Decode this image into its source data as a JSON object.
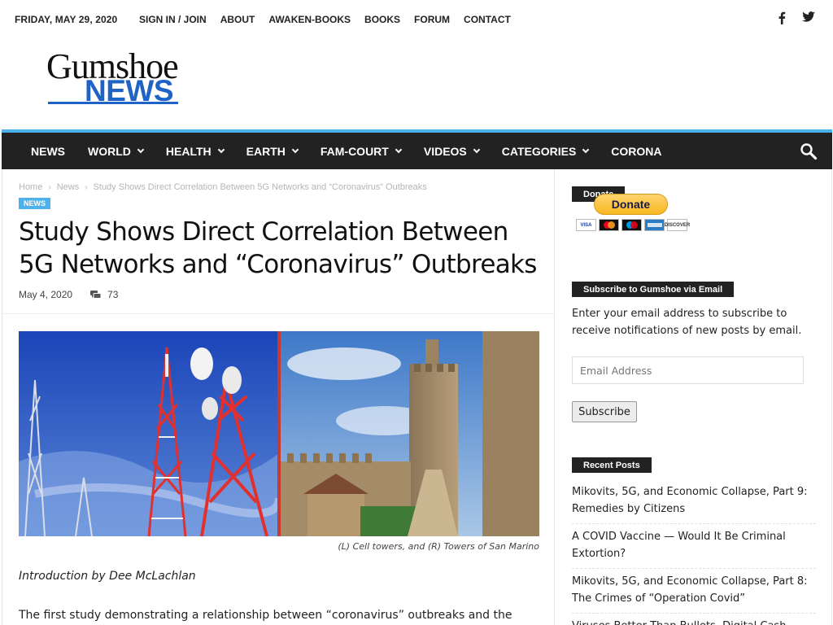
{
  "topbar": {
    "date": "FRIDAY, MAY 29, 2020",
    "menu": [
      "SIGN IN / JOIN",
      "ABOUT",
      "AWAKEN-BOOKS",
      "BOOKS",
      "FORUM",
      "CONTACT"
    ],
    "social": [
      "facebook-icon",
      "twitter-icon"
    ]
  },
  "logo": {
    "line1": "Gumshoe",
    "line2": "NEWS"
  },
  "nav": {
    "items": [
      {
        "label": "NEWS",
        "dropdown": false
      },
      {
        "label": "WORLD",
        "dropdown": true
      },
      {
        "label": "HEALTH",
        "dropdown": true
      },
      {
        "label": "EARTH",
        "dropdown": true
      },
      {
        "label": "FAM-COURT",
        "dropdown": true
      },
      {
        "label": "VIDEOS",
        "dropdown": true
      },
      {
        "label": "CATEGORIES",
        "dropdown": true
      },
      {
        "label": "CORONA",
        "dropdown": false
      }
    ],
    "search_icon": "search-icon"
  },
  "article": {
    "breadcrumb": [
      "Home",
      "News",
      "Study Shows Direct Correlation Between 5G Networks and “Coronavirus” Outbreaks"
    ],
    "category": "NEWS",
    "title": "Study Shows Direct Correlation Between 5G Networks and “Coronavirus” Outbreaks",
    "date": "May 4, 2020",
    "comments": "73",
    "image_caption": "(L) Cell towers, and (R) Towers of San Marino",
    "intro": "Introduction by Dee McLachlan",
    "first_paragraph": "The first study demonstrating a relationship between “coronavirus” outbreaks and the"
  },
  "sidebar": {
    "donate_title": "Donate",
    "donate_button": "Donate",
    "cards": [
      "VISA",
      "MC",
      "MAESTRO",
      "AMEX",
      "DISCOVER"
    ],
    "subscribe_title": "Subscribe to Gumshoe via Email",
    "subscribe_text": "Enter your email address to subscribe to receive notifications of new posts by email.",
    "email_placeholder": "Email Address",
    "subscribe_button": "Subscribe",
    "recent_title": "Recent Posts",
    "recent_posts": [
      "Mikovits, 5G, and Economic Collapse, Part 9: Remedies by Citizens",
      "A COVID Vaccine — Would It Be Criminal Extortion?",
      "Mikovits, 5G, and Economic Collapse, Part 8: The Crimes of “Operation Covid”",
      "Viruses Better Than Bullets, Digital Cash"
    ]
  },
  "colors": {
    "accent": "#4db2ec",
    "nav_bg": "#222222",
    "logo_blue": "#1f63c6"
  }
}
